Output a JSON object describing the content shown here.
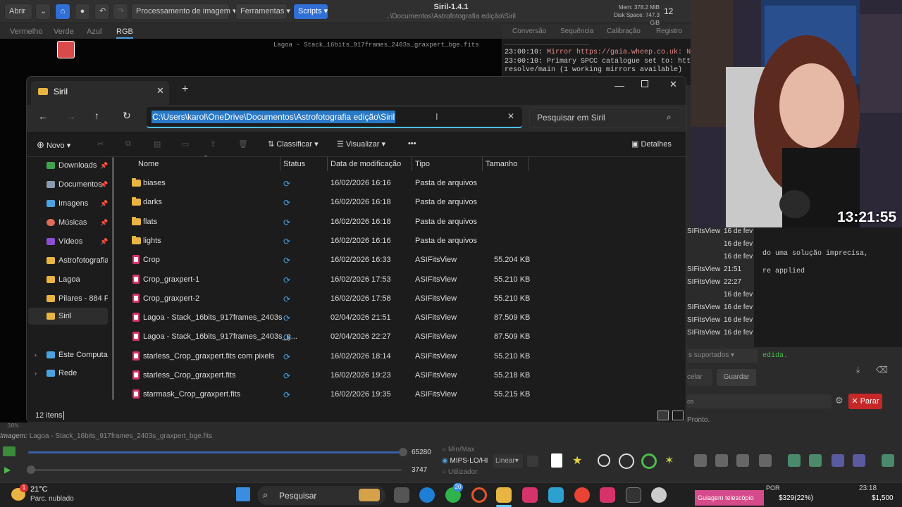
{
  "siril": {
    "open_label": "Abrir",
    "processing_menu": "Processamento de imagem",
    "tools_menu": "Ferramentas",
    "scripts_menu": "Scripts",
    "title": "Siril-1.4.1",
    "path": "..\\Documentos\\Astrofotografia edição\\Siril",
    "mem": "Mem: 378.2 MiB",
    "disk": "Disk Space: 747.3 GiB",
    "threads": "12",
    "channels": [
      "Vermelho",
      "Verde",
      "Azul",
      "RGB"
    ],
    "image_name": "Lagoa - Stack_16bits_917frames_2403s_graxpert_bge.fits",
    "right_tabs": [
      "Conversão",
      "Sequência",
      "Calibração",
      "Registro"
    ],
    "console": {
      "line1_time": "23:00:10:",
      "line1_text": "Mirror https://gaia.wheep.co.uk: N",
      "line2_time": "23:00:10:",
      "line2_text": "Primary SPCC catalogue set to: htt",
      "line3_text": "resolve/main (1 working mirrors available)"
    },
    "bottom": {
      "zoom": "30%",
      "image_label": "Imagem:",
      "image_value": "Lagoa - Stack_16bits_917frames_2403s_graxpert_bge.fits",
      "hi_value": "65280",
      "lo_value": "3747",
      "minmax": "Min/Max",
      "mips": "MIPS-LO/HI",
      "user": "Utilizador",
      "scale": "Linear"
    },
    "right_list": [
      {
        "name": "SIFitsView",
        "date": "16 de fev"
      },
      {
        "name": "",
        "date": "16 de fev"
      },
      {
        "name": "",
        "date": "16 de fev"
      },
      {
        "name": "SIFitsView",
        "date": "21:51"
      },
      {
        "name": "SIFitsView",
        "date": "22:27"
      },
      {
        "name": "",
        "date": "16 de fev"
      },
      {
        "name": "SIFitsView",
        "date": "16 de fev"
      },
      {
        "name": "SIFitsView",
        "date": "16 de fev"
      },
      {
        "name": "SIFitsView",
        "date": "16 de fev"
      }
    ],
    "right_console1": "do uma solução imprecisa,",
    "right_console2": "re applied",
    "right_console3": "edida.",
    "supported": "s suportados",
    "cancel": "celar",
    "save": "Guardar",
    "stop": "Parar",
    "ready": "Pronto."
  },
  "explorer": {
    "tab_title": "Siril",
    "address": "C:\\Users\\karol\\OneDrive\\Documentos\\Astrofotografia edição\\Siril",
    "search_placeholder": "Pesquisar em Siril",
    "new_label": "Novo",
    "sort_label": "Classificar",
    "view_label": "Visualizar",
    "more_label": "•••",
    "details_label": "Detalhes",
    "sidebar": [
      {
        "label": "Downloads",
        "pinned": true,
        "color": "#3fa34d"
      },
      {
        "label": "Documentos",
        "pinned": true,
        "color": "#8a9bb0"
      },
      {
        "label": "Imagens",
        "pinned": true,
        "color": "#4aa3df"
      },
      {
        "label": "Músicas",
        "pinned": true,
        "color": "#e06b5a"
      },
      {
        "label": "Vídeos",
        "pinned": true,
        "color": "#8a4fd0"
      },
      {
        "label": "Astrofotografias",
        "pinned": false,
        "color": "#e8b542"
      },
      {
        "label": "Lagoa",
        "pinned": false,
        "color": "#e8b542"
      },
      {
        "label": "Pilares - 884 Fra",
        "pinned": false,
        "color": "#e8b542"
      },
      {
        "label": "Siril",
        "pinned": false,
        "color": "#e8b542"
      },
      {
        "label": "Este Computador",
        "pinned": false,
        "color": "#4aa3df"
      },
      {
        "label": "Rede",
        "pinned": false,
        "color": "#4aa3df"
      }
    ],
    "columns": [
      "Nome",
      "Status",
      "Data de modificação",
      "Tipo",
      "Tamanho"
    ],
    "files": [
      {
        "name": "biases",
        "date": "16/02/2026 16:16",
        "type": "Pasta de arquivos",
        "size": "",
        "folder": true
      },
      {
        "name": "darks",
        "date": "16/02/2026 16:18",
        "type": "Pasta de arquivos",
        "size": "",
        "folder": true
      },
      {
        "name": "flats",
        "date": "16/02/2026 16:18",
        "type": "Pasta de arquivos",
        "size": "",
        "folder": true
      },
      {
        "name": "lights",
        "date": "16/02/2026 16:16",
        "type": "Pasta de arquivos",
        "size": "",
        "folder": true
      },
      {
        "name": "Crop",
        "date": "16/02/2026 16:33",
        "type": "ASIFitsView",
        "size": "55.204 KB",
        "folder": false
      },
      {
        "name": "Crop_graxpert-1",
        "date": "16/02/2026 17:53",
        "type": "ASIFitsView",
        "size": "55.210 KB",
        "folder": false
      },
      {
        "name": "Crop_graxpert-2",
        "date": "16/02/2026 17:58",
        "type": "ASIFitsView",
        "size": "55.210 KB",
        "folder": false
      },
      {
        "name": "Lagoa - Stack_16bits_917frames_2403s",
        "date": "02/04/2026 21:51",
        "type": "ASIFitsView",
        "size": "87.509 KB",
        "folder": false
      },
      {
        "name": "Lagoa - Stack_16bits_917frames_2403s_g...",
        "date": "02/04/2026 22:27",
        "type": "ASIFitsView",
        "size": "87.509 KB",
        "folder": false
      },
      {
        "name": "starless_Crop_graxpert.fits com pixels",
        "date": "16/02/2026 18:14",
        "type": "ASIFitsView",
        "size": "55.210 KB",
        "folder": false
      },
      {
        "name": "starless_Crop_graxpert.fits",
        "date": "16/02/2026 19:23",
        "type": "ASIFitsView",
        "size": "55.218 KB",
        "folder": false
      },
      {
        "name": "starmask_Crop_graxpert.fits",
        "date": "16/02/2026 19:35",
        "type": "ASIFitsView",
        "size": "55.215 KB",
        "folder": false
      }
    ],
    "status": "12 itens"
  },
  "webcam": {
    "clock": "13:21:55"
  },
  "taskbar": {
    "temp": "21°C",
    "weather": "Parc. nublado",
    "search": "Pesquisar",
    "notif_count": "20",
    "badge_count": "1",
    "stream_label": "Guiagem telescópio",
    "price": "$329(22%)",
    "price2": "$1,500",
    "lang": "POR",
    "time": "23:18"
  }
}
